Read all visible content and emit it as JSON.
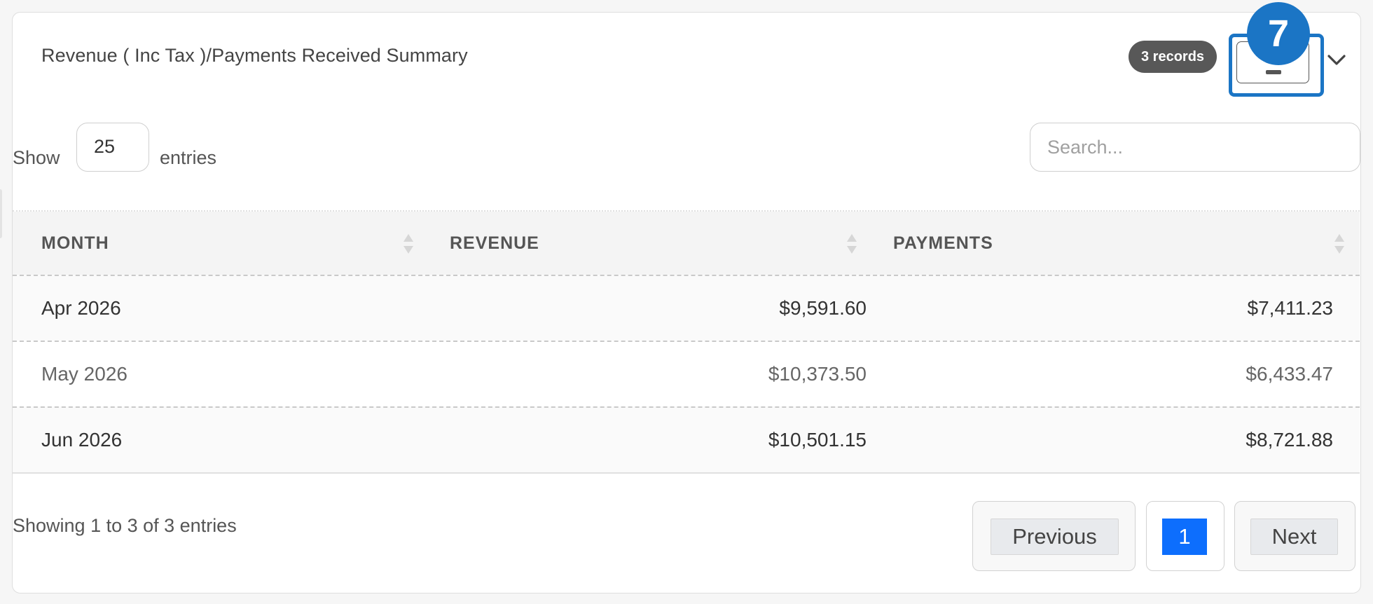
{
  "panel": {
    "title": "Revenue ( Inc Tax )/Payments Received Summary",
    "records_badge": "3 records",
    "step_badge": "7",
    "export_icon": "export-icon",
    "collapse_icon": "chevron-down-icon"
  },
  "length": {
    "label_show": "Show",
    "value": "25",
    "label_entries": "entries"
  },
  "search": {
    "placeholder": "Search..."
  },
  "table": {
    "columns": [
      "MONTH",
      "REVENUE",
      "PAYMENTS"
    ],
    "rows": [
      {
        "month": "Apr 2026",
        "revenue": "$9,591.60",
        "payments": "$7,411.23"
      },
      {
        "month": "May 2026",
        "revenue": "$10,373.50",
        "payments": "$6,433.47"
      },
      {
        "month": "Jun 2026",
        "revenue": "$10,501.15",
        "payments": "$8,721.88"
      }
    ]
  },
  "footer": {
    "info": "Showing 1 to 3 of 3 entries",
    "previous": "Previous",
    "page": "1",
    "next": "Next"
  },
  "colors": {
    "accent": "#1b75c5",
    "active_page": "#0d6efd",
    "badge_bg": "#585858"
  }
}
